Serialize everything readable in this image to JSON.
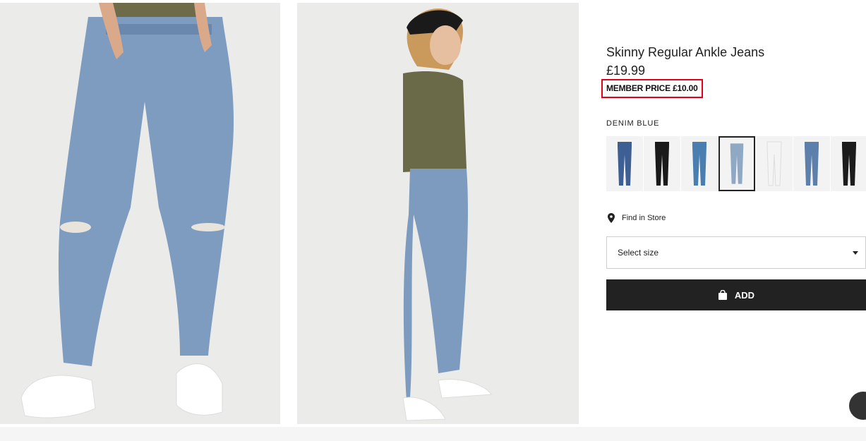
{
  "product": {
    "title": "Skinny Regular Ankle Jeans",
    "price": "£19.99",
    "member_price": "MEMBER PRICE £10.00",
    "highlight_color": "#e3001b"
  },
  "color": {
    "label": "DENIM BLUE",
    "swatches": [
      {
        "name": "dark-blue",
        "fill": "#3d5f94",
        "selected": false
      },
      {
        "name": "black",
        "fill": "#1a1a1a",
        "selected": false
      },
      {
        "name": "ripped-blue",
        "fill": "#4a7eb0",
        "selected": false
      },
      {
        "name": "denim-blue",
        "fill": "#8fa9c5",
        "selected": true
      },
      {
        "name": "white",
        "fill": "#f4f4f4",
        "selected": false
      },
      {
        "name": "mid-blue",
        "fill": "#5c7fac",
        "selected": false
      },
      {
        "name": "black-2",
        "fill": "#1c1c1c",
        "selected": false
      }
    ]
  },
  "store": {
    "label": "Find in Store",
    "icon": "location-pin-icon"
  },
  "size_select": {
    "placeholder": "Select size"
  },
  "add_button": {
    "label": "ADD",
    "icon": "shopping-bag-icon"
  },
  "images": [
    {
      "name": "front-view",
      "alt": ""
    },
    {
      "name": "side-view",
      "alt": ""
    }
  ],
  "chat": {
    "icon": "chat-bubble-icon"
  },
  "colors": {
    "primary": "#222222",
    "image_bg": "#ebebea"
  }
}
